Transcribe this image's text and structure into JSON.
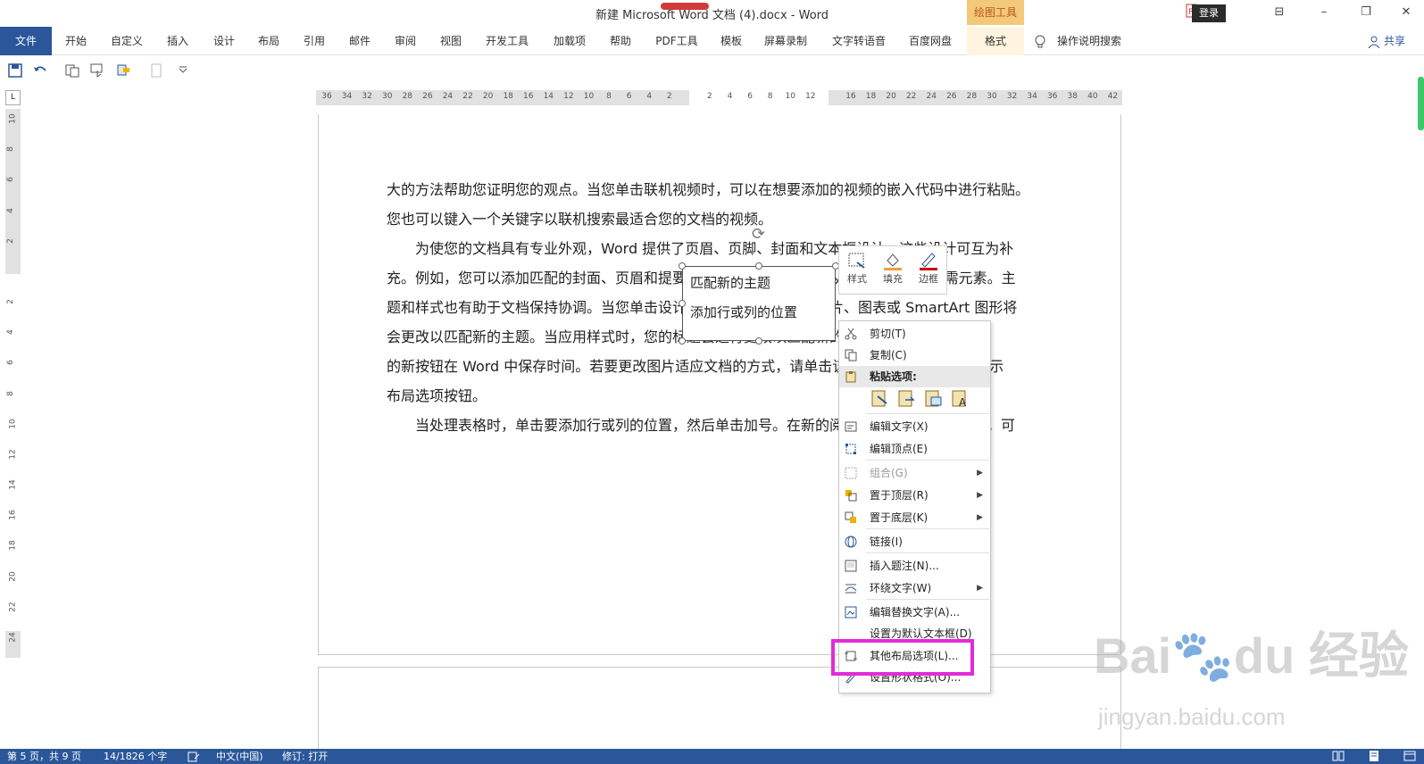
{
  "window": {
    "title": "新建 Microsoft Word 文档 (4).docx  -  Word",
    "drawing_tools": "绘图工具",
    "login": "登录",
    "controls": [
      "⊟",
      "–",
      "❐",
      "✕"
    ]
  },
  "ribbon": {
    "tabs": [
      "文件",
      "开始",
      "自定义",
      "插入",
      "设计",
      "布局",
      "引用",
      "邮件",
      "审阅",
      "视图",
      "开发工具",
      "加载项",
      "帮助",
      "PDF工具",
      "模板",
      "屏幕录制",
      "文字转语音",
      "百度网盘",
      "格式"
    ],
    "tell_me": "操作说明搜索",
    "share": "共享"
  },
  "ruler": {
    "h_ticks": [
      "36",
      "34",
      "32",
      "30",
      "28",
      "26",
      "24",
      "22",
      "20",
      "18",
      "16",
      "14",
      "12",
      "10",
      "8",
      "6",
      "4",
      "2",
      "",
      "2",
      "4",
      "6",
      "8",
      "10",
      "12",
      "",
      "16",
      "18",
      "20",
      "22",
      "24",
      "26",
      "28",
      "30",
      "32",
      "34",
      "36",
      "38",
      "40",
      "42"
    ],
    "v_ticks": [
      "10",
      "8",
      "6",
      "4",
      "2",
      "",
      "2",
      "4",
      "6",
      "8",
      "10",
      "12",
      "14",
      "16",
      "18",
      "20",
      "22",
      "24"
    ]
  },
  "document": {
    "lines": [
      "大的方法帮助您证明您的观点。当您单击联机视频时，可以在想要添加的视频的嵌入代码中进行粘贴。",
      "您也可以键入一个关键字以联机搜索最适合您的文档的视频。",
      "为使您的文档具有专业外观，Word  提供了页眉、页脚、封面和文本框设计，这些设计可互为补",
      "充。例如，您可以添加匹配的封面、页眉和提要栏。单击“插入”，然后从不同库中选择所需元素。主",
      "题和样式也有助于文档保持协调。当您单击设计并选择新的主题时，图片、图表或 SmartArt 图形将",
      "会更改以匹配新的主题。当应用样式时，您的标题会进行更改以匹配新的主题。在需要位置出现",
      "的新按钮在 Word 中保存时间。若要更改图片适应文档的方式，请单击该图片，图片旁边将会显示",
      "布局选项按钮。",
      "当处理表格时，单击要添加行或列的位置，然后单击加号。在新的阅读视图中阅读更加容易。可"
    ]
  },
  "textbox": {
    "line1": "匹配新的主题",
    "line2": "添加行或列的位置"
  },
  "mini_toolbar": {
    "style": "样式",
    "fill": "填充",
    "border": "边框"
  },
  "context_menu": {
    "cut": "剪切(T)",
    "copy": "复制(C)",
    "paste_options": "粘贴选项:",
    "edit_text": "编辑文字(X)",
    "edit_points": "编辑顶点(E)",
    "group": "组合(G)",
    "bring_front": "置于顶层(R)",
    "send_back": "置于底层(K)",
    "link": "链接(I)",
    "insert_caption": "插入题注(N)...",
    "wrap_text": "环绕文字(W)",
    "edit_alt": "编辑替换文字(A)...",
    "set_default": "设置为默认文本框(D)",
    "more_layout": "其他布局选项(L)...",
    "format_shape": "设置形状格式(O)..."
  },
  "watermark": {
    "brand": "Bai du 经验",
    "url": "jingyan.baidu.com"
  },
  "status": {
    "page": "第 5 页，共 9 页",
    "words": "14/1826 个字",
    "language": "中文(中国)",
    "track": "修订: 打开"
  },
  "colors": {
    "accent": "#2b579a",
    "highlight": "#e12bd9",
    "drawing_tab": "#f4c87a"
  }
}
